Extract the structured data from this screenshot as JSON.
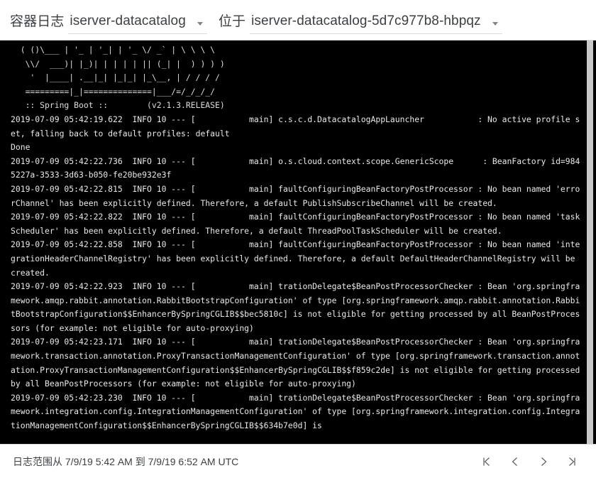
{
  "header": {
    "container_logs_label": "容器日志",
    "container_name": "iserver-datacatalog",
    "located_at_label": "位于",
    "pod_name": "iserver-datacatalog-5d7c977b8-hbpqz",
    "container_caret_icon": "chevron-down-icon",
    "pod_caret_icon": "chevron-down-icon"
  },
  "log": {
    "banner": "  ( ()\\___ | '_ | '_| | '_ \\/ _` | \\ \\ \\ \\\n   \\\\/  ___)| |_)| | | | | || (_| |  ) ) ) )\n    '  |____| .__|_| |_|_| |_\\__, | / / / /\n   =========|_|==============|___/=/_/_/_/\n   :: Spring Boot ::        (v2.1.3.RELEASE)",
    "lines": [
      "2019-07-09 05:42:19.622  INFO 10 --- [           main] c.s.c.d.DatacatalogAppLauncher           : No active profile set, falling back to default profiles: default",
      "Done",
      "2019-07-09 05:42:22.736  INFO 10 --- [           main] o.s.cloud.context.scope.GenericScope      : BeanFactory id=9845227a-3533-3d63-b050-fe20be932e3f",
      "2019-07-09 05:42:22.815  INFO 10 --- [           main] faultConfiguringBeanFactoryPostProcessor : No bean named 'errorChannel' has been explicitly defined. Therefore, a default PublishSubscribeChannel will be created.",
      "2019-07-09 05:42:22.822  INFO 10 --- [           main] faultConfiguringBeanFactoryPostProcessor : No bean named 'taskScheduler' has been explicitly defined. Therefore, a default ThreadPoolTaskScheduler will be created.",
      "2019-07-09 05:42:22.858  INFO 10 --- [           main] faultConfiguringBeanFactoryPostProcessor : No bean named 'integrationHeaderChannelRegistry' has been explicitly defined. Therefore, a default DefaultHeaderChannelRegistry will be created.",
      "2019-07-09 05:42:22.923  INFO 10 --- [           main] trationDelegate$BeanPostProcessorChecker : Bean 'org.springframework.amqp.rabbit.annotation.RabbitBootstrapConfiguration' of type [org.springframework.amqp.rabbit.annotation.RabbitBootstrapConfiguration$$EnhancerBySpringCGLIB$$bec5810c] is not eligible for getting processed by all BeanPostProcessors (for example: not eligible for auto-proxying)",
      "2019-07-09 05:42:23.171  INFO 10 --- [           main] trationDelegate$BeanPostProcessorChecker : Bean 'org.springframework.transaction.annotation.ProxyTransactionManagementConfiguration' of type [org.springframework.transaction.annotation.ProxyTransactionManagementConfiguration$$EnhancerBySpringCGLIB$$f859c2de] is not eligible for getting processed by all BeanPostProcessors (for example: not eligible for auto-proxying)",
      "2019-07-09 05:42:23.230  INFO 10 --- [           main] trationDelegate$BeanPostProcessorChecker : Bean 'org.springframework.integration.config.IntegrationManagementConfiguration' of type [org.springframework.integration.config.IntegrationManagementConfiguration$$EnhancerBySpringCGLIB$$634b7e0d] is"
    ]
  },
  "footer": {
    "range_text": "日志范围从 7/9/19 5:42 AM 到 7/9/19 6:52 AM UTC",
    "pager": {
      "first_label": "|<",
      "prev_label": "<",
      "next_label": ">",
      "last_label": ">|"
    }
  },
  "colors": {
    "log_background": "#000000",
    "log_text": "#e8e8e8",
    "panel_background": "#ffffff",
    "border": "#dcdcdc",
    "icon": "#5f6368"
  }
}
